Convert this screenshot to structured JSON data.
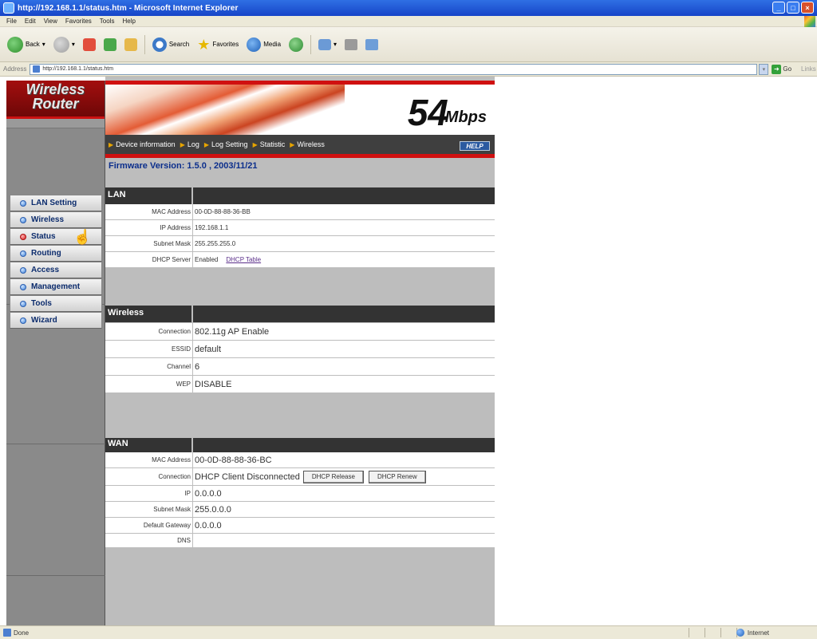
{
  "window": {
    "title": "http://192.168.1.1/status.htm - Microsoft Internet Explorer"
  },
  "menu": [
    "File",
    "Edit",
    "View",
    "Favorites",
    "Tools",
    "Help"
  ],
  "toolbar": {
    "back_label": "Back",
    "search_label": "Search",
    "favorites_label": "Favorites",
    "media_label": "Media"
  },
  "address": {
    "label": "Address",
    "url": "http://192.168.1.1/status.htm",
    "go_label": "Go",
    "links_label": "Links"
  },
  "sidebar": {
    "logo_line1": "Wireless",
    "logo_line2": "Router",
    "items": [
      {
        "label": "LAN Setting"
      },
      {
        "label": "Wireless"
      },
      {
        "label": "Status"
      },
      {
        "label": "Routing"
      },
      {
        "label": "Access"
      },
      {
        "label": "Management"
      },
      {
        "label": "Tools"
      },
      {
        "label": "Wizard"
      }
    ],
    "active_index": 2
  },
  "banner": {
    "speed": "54",
    "unit": "Mbps"
  },
  "tabs": [
    "Device information",
    "Log",
    "Log Setting",
    "Statistic",
    "Wireless"
  ],
  "help_label": "HELP",
  "firmware": "Firmware Version: 1.5.0 , 2003/11/21",
  "lan": {
    "heading": "LAN",
    "mac_label": "MAC Address",
    "mac": "00-0D-88-88-36-BB",
    "ip_label": "IP Address",
    "ip": "192.168.1.1",
    "mask_label": "Subnet Mask",
    "mask": "255.255.255.0",
    "dhcp_label": "DHCP Server",
    "dhcp": "Enabled",
    "dhcp_link": "DHCP Table"
  },
  "wireless": {
    "heading": "Wireless",
    "conn_label": "Connection",
    "conn": "802.11g AP Enable",
    "essid_label": "ESSID",
    "essid": "default",
    "channel_label": "Channel",
    "channel": "6",
    "wep_label": "WEP",
    "wep": "DISABLE"
  },
  "wan": {
    "heading": "WAN",
    "mac_label": "MAC Address",
    "mac": "00-0D-88-88-36-BC",
    "conn_label": "Connection",
    "conn": "DHCP Client Disconnected",
    "release_label": "DHCP Release",
    "renew_label": "DHCP Renew",
    "ip_label": "IP",
    "ip": "0.0.0.0",
    "mask_label": "Subnet Mask",
    "mask": "255.0.0.0",
    "gateway_label": "Default Gateway",
    "gateway": "0.0.0.0",
    "dns_label": "DNS",
    "dns": ""
  },
  "status": {
    "left": "Done",
    "zone": "Internet"
  },
  "colors": {
    "accent_red": "#d01010",
    "nav_text": "#0b2b6c",
    "firmware_text": "#0b2e8c"
  }
}
